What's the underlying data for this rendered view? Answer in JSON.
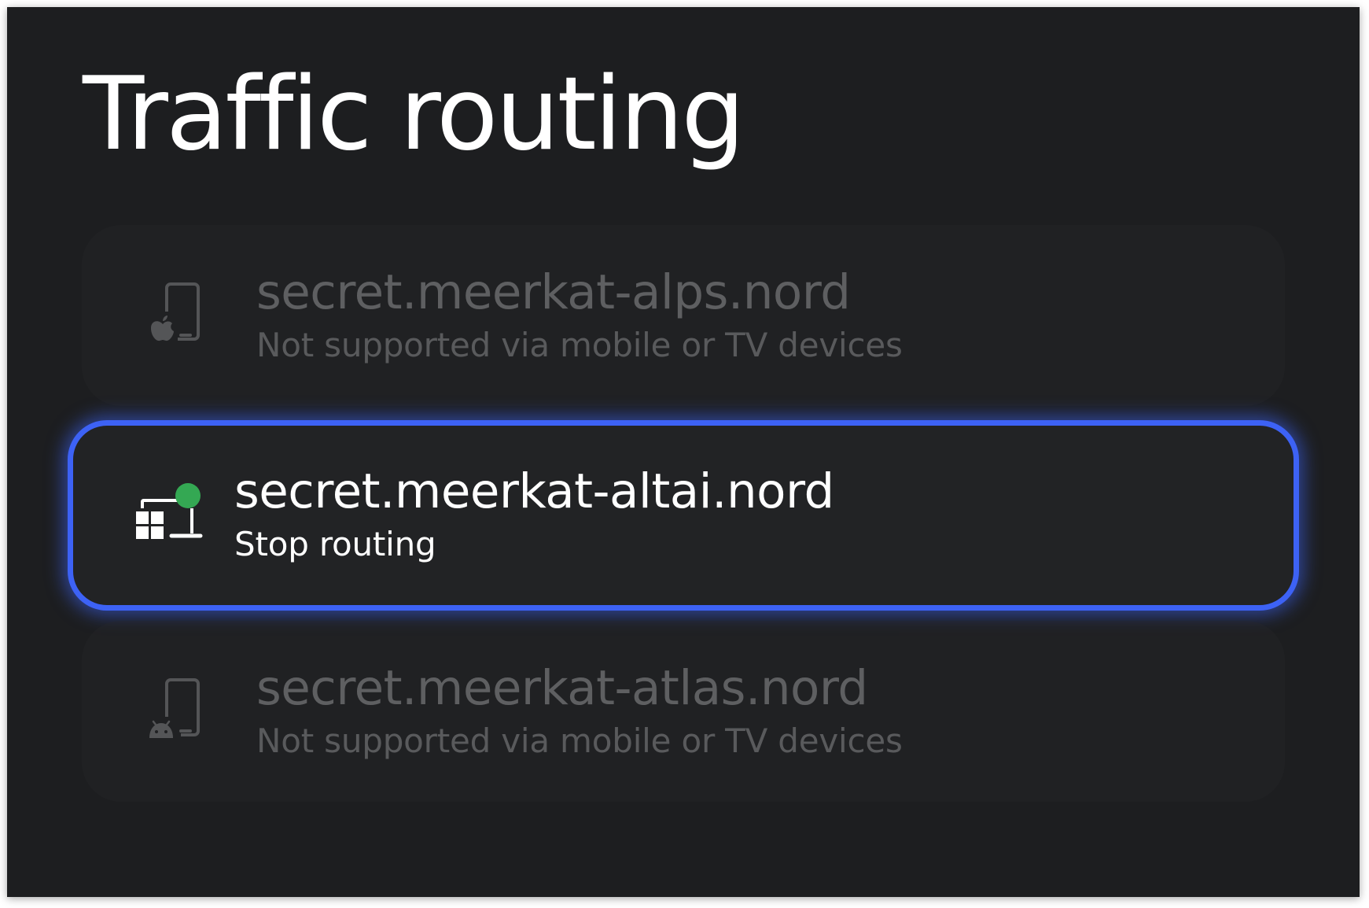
{
  "page": {
    "title": "Traffic routing"
  },
  "devices": [
    {
      "name": "secret.meerkat-alps.nord",
      "subtitle": "Not supported via mobile or TV devices",
      "icon": "apple-phone-icon",
      "state": "disabled"
    },
    {
      "name": "secret.meerkat-altai.nord",
      "subtitle": "Stop routing",
      "icon": "windows-routing-icon",
      "state": "focused",
      "status_color": "#34a853"
    },
    {
      "name": "secret.meerkat-atlas.nord",
      "subtitle": "Not supported via mobile or TV devices",
      "icon": "android-phone-icon",
      "state": "disabled"
    }
  ],
  "colors": {
    "background": "#1d1e20",
    "card": "#28292b",
    "focus_ring": "#3d62f5",
    "text": "#ffffff"
  }
}
